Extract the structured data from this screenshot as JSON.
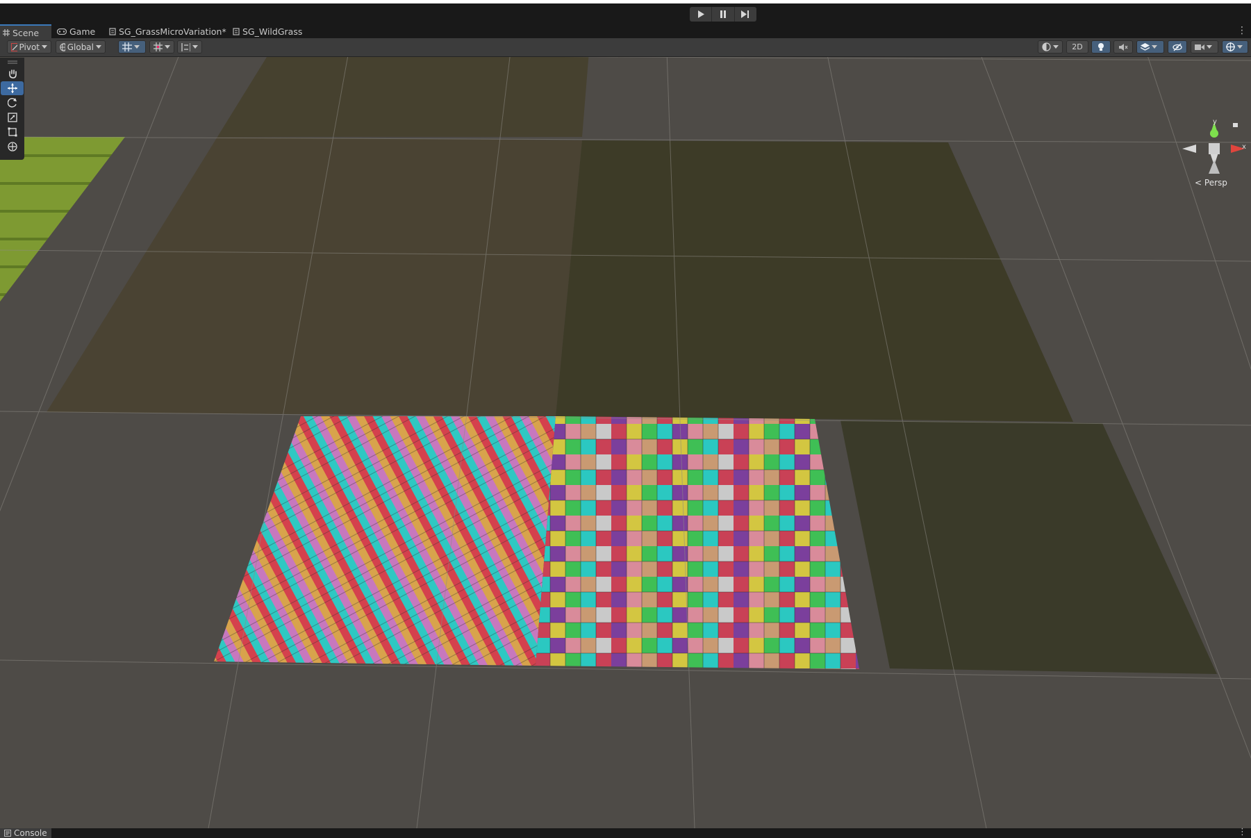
{
  "playmode": {
    "play_icon": "play-icon",
    "pause_icon": "pause-icon",
    "step_icon": "step-icon"
  },
  "tabs": [
    {
      "label": "Scene",
      "icon": "grid-icon",
      "active": true
    },
    {
      "label": "Game",
      "icon": "gamepad-icon",
      "active": false
    },
    {
      "label": "SG_GrassMicroVariation*",
      "icon": "shader-graph-icon",
      "active": false
    },
    {
      "label": "SG_WildGrass",
      "icon": "shader-graph-icon",
      "active": false
    }
  ],
  "toolbar": {
    "pivot_label": "Pivot",
    "global_label": "Global",
    "mode_2d_label": "2D"
  },
  "tools": [
    {
      "name": "hand-tool",
      "icon": "hand-icon",
      "active": false
    },
    {
      "name": "move-tool",
      "icon": "move-icon",
      "active": true
    },
    {
      "name": "rotate-tool",
      "icon": "rotate-icon",
      "active": false
    },
    {
      "name": "scale-tool",
      "icon": "scale-icon",
      "active": false
    },
    {
      "name": "rect-tool",
      "icon": "rect-icon",
      "active": false
    },
    {
      "name": "transform-tool",
      "icon": "transform-icon",
      "active": false
    }
  ],
  "gizmo": {
    "y_label": "y",
    "x_label": "x",
    "projection_label": "Persp"
  },
  "console": {
    "label": "Console"
  },
  "colors": {
    "accent": "#3a79bb",
    "panel": "#3c3c3c",
    "background": "#191919",
    "grass_light": "#7e9a32",
    "dirt": "#4a4333",
    "dark_grass": "#3d3b27"
  }
}
